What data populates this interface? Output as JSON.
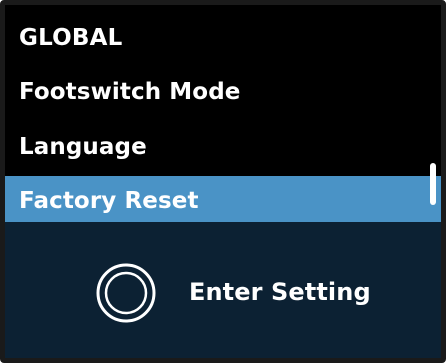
{
  "screen": {
    "title": "GLOBAL"
  },
  "menu": {
    "items": [
      {
        "label": "Footswitch Mode",
        "selected": false
      },
      {
        "label": "Language",
        "selected": false
      },
      {
        "label": "Factory Reset",
        "selected": true
      }
    ]
  },
  "action": {
    "icon": "knob-circle-icon",
    "label": "Enter Setting"
  },
  "colors": {
    "background": "#000000",
    "selection": "#4a93c6",
    "panel": "#0c2133",
    "text": "#ffffff"
  }
}
